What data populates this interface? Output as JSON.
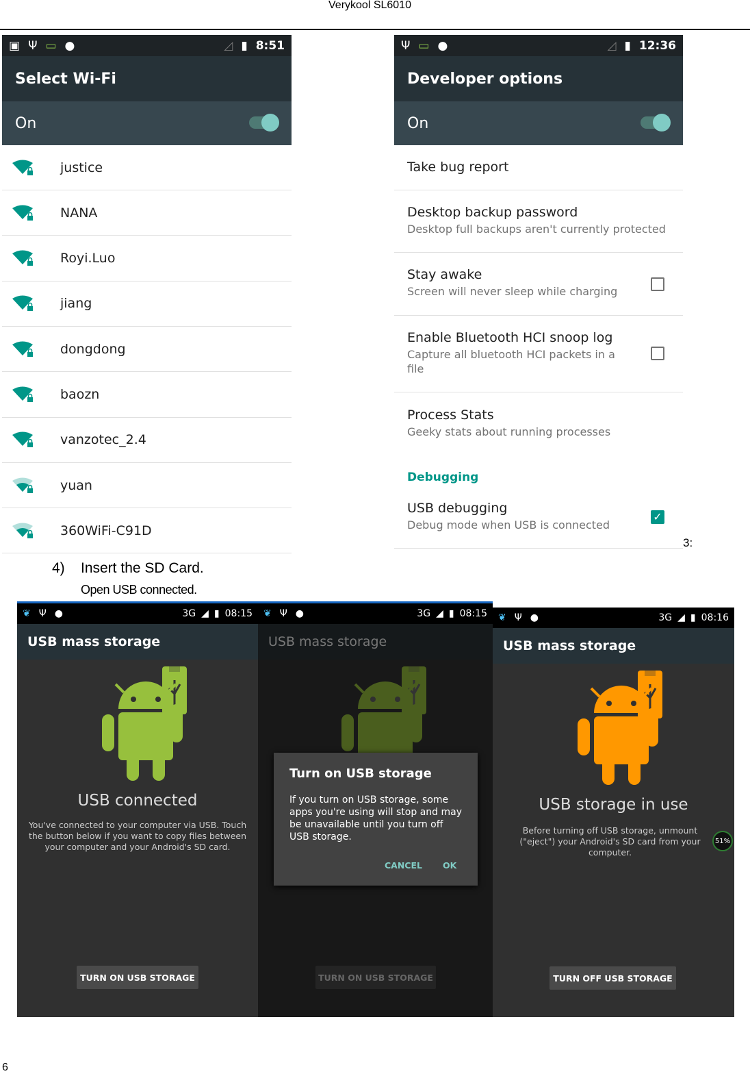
{
  "doc": {
    "header": "Verykool SL6010",
    "step3_label": "3:",
    "step4_num": "4)",
    "step4_text": "Insert the SD Card.",
    "step4_sub": "Open USB connected.",
    "page_number": "6"
  },
  "colors": {
    "teal": "#009688",
    "android_green": "#97c03d",
    "android_orange": "#ff9800",
    "appbar": "#263238"
  },
  "wifi": {
    "time": "8:51",
    "title": "Select Wi-Fi",
    "toggle_label": "On",
    "toggle_on": true,
    "networks": [
      {
        "name": "justice",
        "signal": "full"
      },
      {
        "name": "NANA",
        "signal": "full"
      },
      {
        "name": "Royi.Luo",
        "signal": "full"
      },
      {
        "name": "jiang",
        "signal": "full"
      },
      {
        "name": "dongdong",
        "signal": "full"
      },
      {
        "name": "baozn",
        "signal": "full"
      },
      {
        "name": "vanzotec_2.4",
        "signal": "full"
      },
      {
        "name": "yuan",
        "signal": "medium"
      },
      {
        "name": "360WiFi-C91D",
        "signal": "medium"
      }
    ]
  },
  "dev": {
    "time": "12:36",
    "title": "Developer options",
    "toggle_label": "On",
    "items": [
      {
        "title": "Take bug report",
        "summary": ""
      },
      {
        "title": "Desktop backup password",
        "summary": "Desktop full backups aren't currently protected"
      },
      {
        "title": "Stay awake",
        "summary": "Screen will never sleep while charging",
        "checked": false
      },
      {
        "title": "Enable Bluetooth HCI snoop log",
        "summary": "Capture all bluetooth HCI packets in a file",
        "checked": false
      },
      {
        "title": "Process Stats",
        "summary": "Geeky stats about running processes"
      }
    ],
    "section": "Debugging",
    "usb_debugging": {
      "title": "USB debugging",
      "summary": "Debug mode when USB is connected",
      "checked": true
    }
  },
  "usb1": {
    "network": "3G",
    "time": "08:15",
    "title": "USB mass storage",
    "heading": "USB connected",
    "text": "You've connected to your computer via USB. Touch the button below if you want to copy files between your computer and your Android's SD card.",
    "button": "TURN ON USB STORAGE"
  },
  "usb2": {
    "network": "3G",
    "time": "08:15",
    "title": "USB mass storage",
    "button": "TURN ON USB STORAGE",
    "dialog": {
      "title": "Turn on USB storage",
      "text": "If you turn on USB storage, some apps you're using will stop and may be unavailable until you turn off USB storage.",
      "cancel": "CANCEL",
      "ok": "OK"
    }
  },
  "usb3": {
    "network": "3G",
    "time": "08:16",
    "title": "USB mass storage",
    "heading": "USB storage in use",
    "text": "Before turning off USB storage, unmount (\"eject\") your Android's SD card from your computer.",
    "button": "TURN OFF USB STORAGE",
    "badge": "51%"
  }
}
